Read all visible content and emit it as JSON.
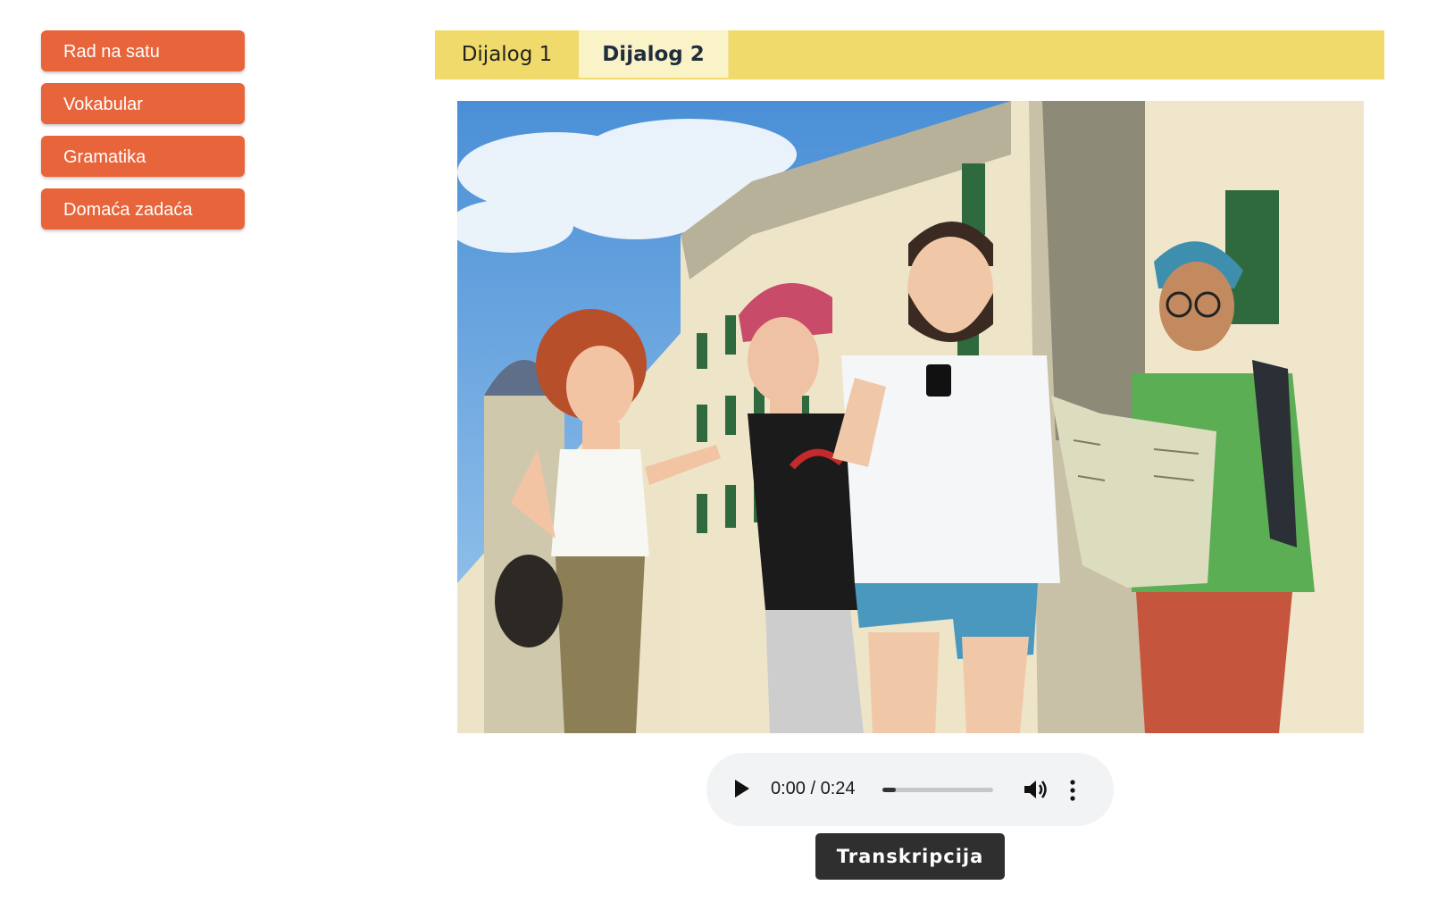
{
  "sidebar": {
    "items": [
      {
        "label": "Rad na satu"
      },
      {
        "label": "Vokabular"
      },
      {
        "label": "Gramatika"
      },
      {
        "label": "Domaća zadaća"
      }
    ]
  },
  "tabs": [
    {
      "label": "Dijalog 1",
      "active": false
    },
    {
      "label": "Dijalog 2",
      "active": true
    }
  ],
  "illustration": {
    "subject": "four young tourists with a map and a phone on a street of old stone buildings"
  },
  "audio": {
    "time": "0:00 / 0:24",
    "progress_fraction": 0.12,
    "icons": [
      "play-icon",
      "volume-icon",
      "more-options-icon"
    ]
  },
  "transcript_button": {
    "label": "Transkripcija"
  },
  "colors": {
    "sidebar_button": "#e8643a",
    "tab_bar": "#efda6b",
    "active_tab": "#fbf3c8",
    "transcript_button": "#2f2f2f",
    "audio_bg": "#f1f3f4"
  }
}
